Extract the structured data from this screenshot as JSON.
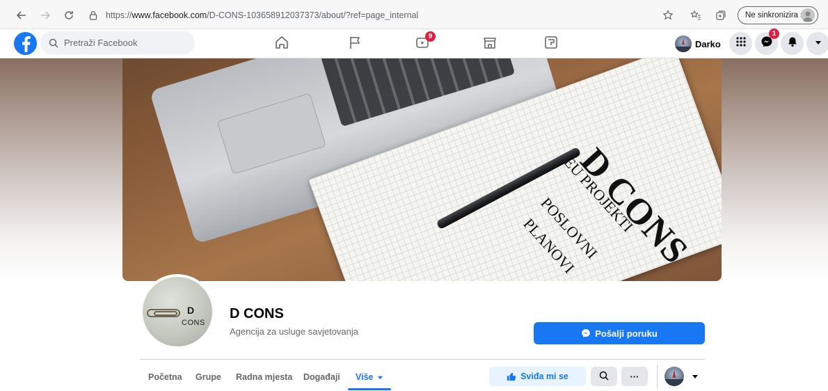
{
  "browser": {
    "url_prefix": "https://",
    "url_domain": "www.facebook.com",
    "url_path": "/D-CONS-103658912037373/about/?ref=page_internal",
    "sync_label": "Ne sinkronizira se"
  },
  "topbar": {
    "search_placeholder": "Pretraži Facebook",
    "watch_badge": "9",
    "user_name": "Darko",
    "messenger_badge": "1"
  },
  "cover": {
    "brand": "D CONS",
    "line1": "EU PROJEKTI",
    "line2": "POSLOVNI",
    "line3": "PLANOVI"
  },
  "profile_pic": {
    "letter": "D",
    "word": "CONS"
  },
  "page": {
    "title": "D CONS",
    "subtitle": "Agencija za usluge savjetovanja",
    "message_button": "Pošalji poruku"
  },
  "tabs": [
    {
      "label": "Početna"
    },
    {
      "label": "Grupe"
    },
    {
      "label": "Radna mjesta"
    },
    {
      "label": "Događaji"
    },
    {
      "label": "Više"
    }
  ],
  "actions": {
    "like_label": "Sviđa mi se",
    "more_label": "···"
  },
  "colors": {
    "brand_blue": "#1877f2",
    "badge_red": "#e41e3f"
  }
}
